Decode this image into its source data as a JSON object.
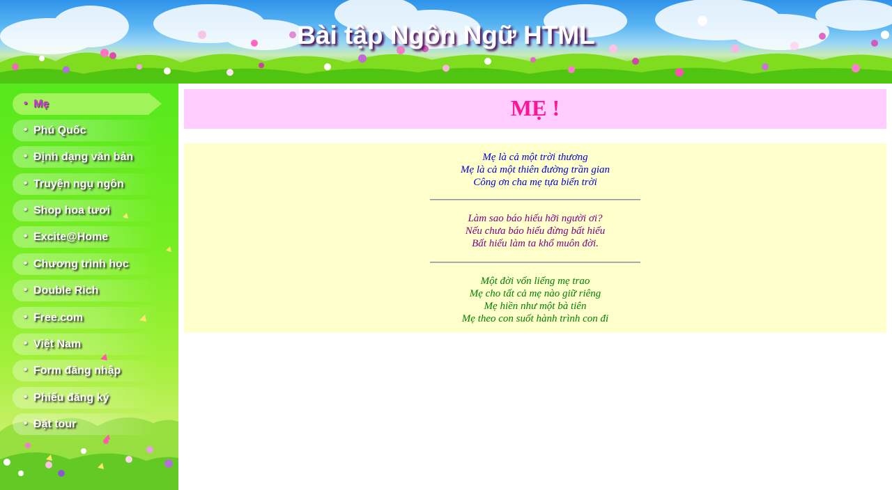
{
  "header": {
    "title": "Bài tập Ngôn Ngữ HTML"
  },
  "sidebar": {
    "items": [
      {
        "label": "Mẹ",
        "active": true
      },
      {
        "label": "Phú Quốc"
      },
      {
        "label": "Định dạng văn bản"
      },
      {
        "label": "Truyện ngụ ngôn"
      },
      {
        "label": "Shop hoa tươi"
      },
      {
        "label": "Excite@Home"
      },
      {
        "label": "Chương trình học"
      },
      {
        "label": "Double Rich"
      },
      {
        "label": "Free.com"
      },
      {
        "label": "Việt Nam"
      },
      {
        "label": "Form đăng nhập"
      },
      {
        "label": "Phiếu đăng ký"
      },
      {
        "label": "Đặt tour"
      }
    ],
    "bullet": "•"
  },
  "main": {
    "title": "MẸ !",
    "stanzas": [
      {
        "lines": [
          "Mẹ là cả một trời thương",
          "Mẹ là cả một thiên đường trần gian",
          "Công ơn cha mẹ tựa biển trời"
        ]
      },
      {
        "lines": [
          "Làm sao báo hiếu hỡi người ơi?",
          "Nếu chưa báo hiếu đừng bất hiếu",
          "Bất hiếu làm ta khổ muôn đời."
        ]
      },
      {
        "lines": [
          "Một đời vốn liếng mẹ trao",
          "Mẹ cho tất cả mẹ nào giữ riêng",
          "Mẹ hiền như một bà tiên",
          "Mẹ theo con suốt hành trình con đi"
        ]
      }
    ]
  },
  "colors": {
    "title_box_bg": "#ffccff",
    "title_text": "#ff1493",
    "poem_box_bg": "#ffffcc",
    "stanza_1": "#0000cc",
    "stanza_2": "#800080",
    "stanza_3": "#008000",
    "active_menu_text": "#d63fd0",
    "sidebar_green": "#66e81e"
  }
}
